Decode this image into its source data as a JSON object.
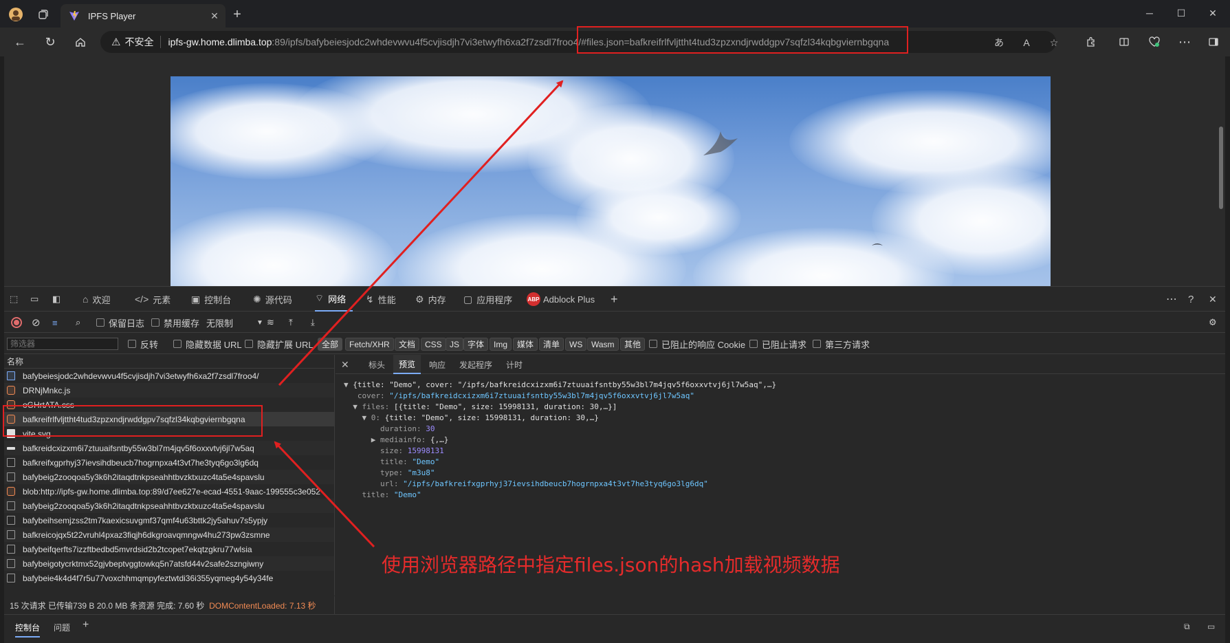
{
  "browser": {
    "tab_title": "IPFS Player",
    "insecure_label": "不安全",
    "url_host": "ipfs-gw.home.dlimba.top",
    "url_rest": ":89/ipfs/bafybeiesjodc2whdevwvu4f5cvjisdjh7vi3etwyfh6xa2f7zsdl7froo4/#files.json=bafkreifrlfvljttht4tud3zpzxndjrwddgpv7sqfzl34kqbgviernbgqna"
  },
  "devtools": {
    "tabs": [
      {
        "label": "欢迎",
        "icon": "home-icon"
      },
      {
        "label": "元素",
        "icon": "code-icon"
      },
      {
        "label": "控制台",
        "icon": "console-icon"
      },
      {
        "label": "源代码",
        "icon": "bug-icon"
      },
      {
        "label": "网络",
        "icon": "wifi-icon"
      },
      {
        "label": "性能",
        "icon": "performance-icon"
      },
      {
        "label": "内存",
        "icon": "memory-icon"
      },
      {
        "label": "应用程序",
        "icon": "application-icon"
      },
      {
        "label": "Adblock Plus",
        "icon": "abp-icon"
      }
    ],
    "abp_badge": "ABP",
    "toolbar": {
      "preserve_log": "保留日志",
      "disable_cache": "禁用缓存",
      "throttle": "无限制"
    },
    "filter": {
      "placeholder": "筛选器",
      "invert": "反转",
      "hide_data_url": "隐藏数据 URL",
      "hide_ext_url": "隐藏扩展 URL",
      "types": [
        "全部",
        "Fetch/XHR",
        "文档",
        "CSS",
        "JS",
        "字体",
        "Img",
        "媒体",
        "清单",
        "WS",
        "Wasm",
        "其他"
      ],
      "blocked_cookies": "已阻止的响应 Cookie",
      "blocked_requests": "已阻止请求",
      "third_party": "第三方请求"
    },
    "list_header": "名称",
    "requests": [
      {
        "name": "bafybeiesjodc2whdevwvu4f5cvjisdjh7vi3etwyfh6xa2f7zsdl7froo4/",
        "type": "doc"
      },
      {
        "name": "DRNjMnkc.js",
        "type": "xhr"
      },
      {
        "name": "oGHrtATA.css",
        "type": "xhr"
      },
      {
        "name": "bafkreifrlfvljttht4tud3zpzxndjrwddgpv7sqfzl34kqbgviernbgqna",
        "type": "xhr"
      },
      {
        "name": "vite.svg",
        "type": "img"
      },
      {
        "name": "bafkreidcxizxm6i7ztuuaifsntby55w3bl7m4jqv5f6oxxvtvj6jl7w5aq",
        "type": "media"
      },
      {
        "name": "bafkreifxgprhyj37ievsihdbeucb7hogrnpxa4t3vt7he3tyq6go3lg6dq",
        "type": "file"
      },
      {
        "name": "bafybeig2zooqoa5y3k6h2itaqdtnkpseahhtbvzktxuzc4ta5e4spavslu",
        "type": "file"
      },
      {
        "name": "blob:http://ipfs-gw.home.dlimba.top:89/d7ee627e-ecad-4551-9aac-199555c3e052",
        "type": "xhr"
      },
      {
        "name": "bafybeig2zooqoa5y3k6h2itaqdtnkpseahhtbvzktxuzc4ta5e4spavslu",
        "type": "file"
      },
      {
        "name": "bafybeihsemjzss2tm7kaexicsuvgmf37qmf4u63bttk2jy5ahuv7s5ypjy",
        "type": "file"
      },
      {
        "name": "bafkreicojqx5t22vruhl4pxaz3fiqjh6dkgroavqmngw4hu273pw3zsmne",
        "type": "file"
      },
      {
        "name": "bafybeifqerfts7izzftbedbd5mvrdsid2b2tcopet7ekqtzgkru77wlsia",
        "type": "file"
      },
      {
        "name": "bafybeigotycrktmx52gjvbeptvggtowkq5n7atsfd44v2safe2szngiwny",
        "type": "file"
      },
      {
        "name": "bafybeie4k4d4f7r5u77voxchhmqmpyfeztwtdi36i355yqmeg4y54y34fe",
        "type": "file"
      }
    ],
    "status": {
      "summary": "15 次请求  已传输739 B  20.0 MB 条资源  完成: 7.60 秒",
      "dom_content_loaded": "DOMContentLoaded: 7.13 秒"
    },
    "detail_tabs": [
      "标头",
      "预览",
      "响应",
      "发起程序",
      "计时"
    ],
    "preview": {
      "root_summary": "{title: \"Demo\", cover: \"/ipfs/bafkreidcxizxm6i7ztuuaifsntby55w3bl7m4jqv5f6oxxvtvj6jl7w5aq\",…}",
      "cover_key": "cover: ",
      "cover_value": "\"/ipfs/bafkreidcxizxm6i7ztuuaifsntby55w3bl7m4jqv5f6oxxvtvj6jl7w5aq\"",
      "files_key": "files: ",
      "files_summary": "[{title: \"Demo\", size: 15998131, duration: 30,…}]",
      "item0_key": "0: ",
      "item0_summary": "{title: \"Demo\", size: 15998131, duration: 30,…}",
      "duration_key": "duration: ",
      "duration_value": "30",
      "mediainfo_key": "mediainfo: ",
      "mediainfo_summary": "{,…}",
      "size_key": "size: ",
      "size_value": "15998131",
      "title_key": "title: ",
      "title_value": "\"Demo\"",
      "type_key": "type: ",
      "type_value": "\"m3u8\"",
      "url_key": "url: ",
      "url_value": "\"/ipfs/bafkreifxgprhyj37ievsihdbeucb7hogrnpxa4t3vt7he3tyq6go3lg6dq\"",
      "root_title_key": "title: ",
      "root_title_value": "\"Demo\""
    },
    "drawer_tabs": [
      "控制台",
      "问题"
    ]
  },
  "annotation": {
    "caption": "使用浏览器路径中指定files.json的hash加载视频数据",
    "color": "#e02020"
  }
}
